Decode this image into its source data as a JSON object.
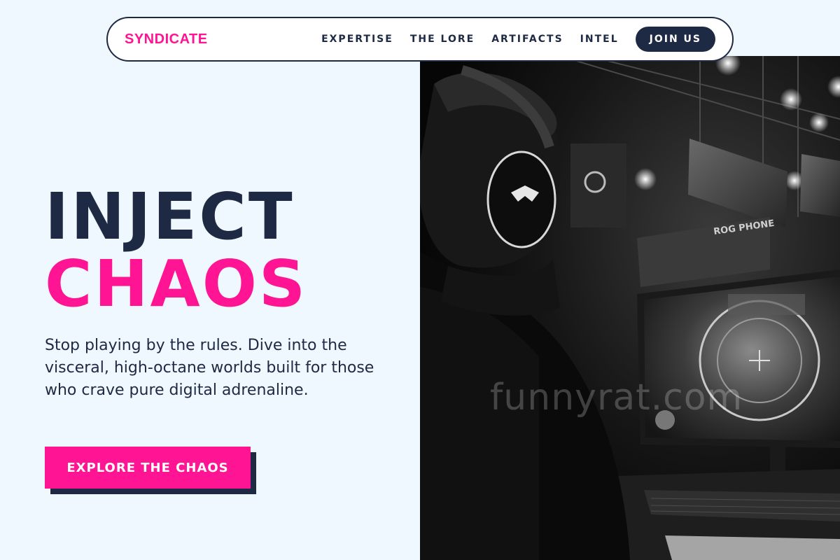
{
  "nav": {
    "brand": "SYNDICATE",
    "links": [
      "EXPERTISE",
      "THE LORE",
      "ARTIFACTS",
      "INTEL"
    ],
    "cta": "JOIN US"
  },
  "hero": {
    "title_line1": "INJECT",
    "title_line2": "CHAOS",
    "description": "Stop playing by the rules. Dive into the visceral, high-octane worlds built for those who crave pure digital adrenaline.",
    "cta": "EXPLORE THE CHAOS"
  },
  "image": {
    "watermark": "funnyrat.com",
    "banner_text": "ROG PHONE"
  },
  "colors": {
    "background": "#eff7ff",
    "navy": "#1e2a44",
    "accent": "#ff1493"
  }
}
